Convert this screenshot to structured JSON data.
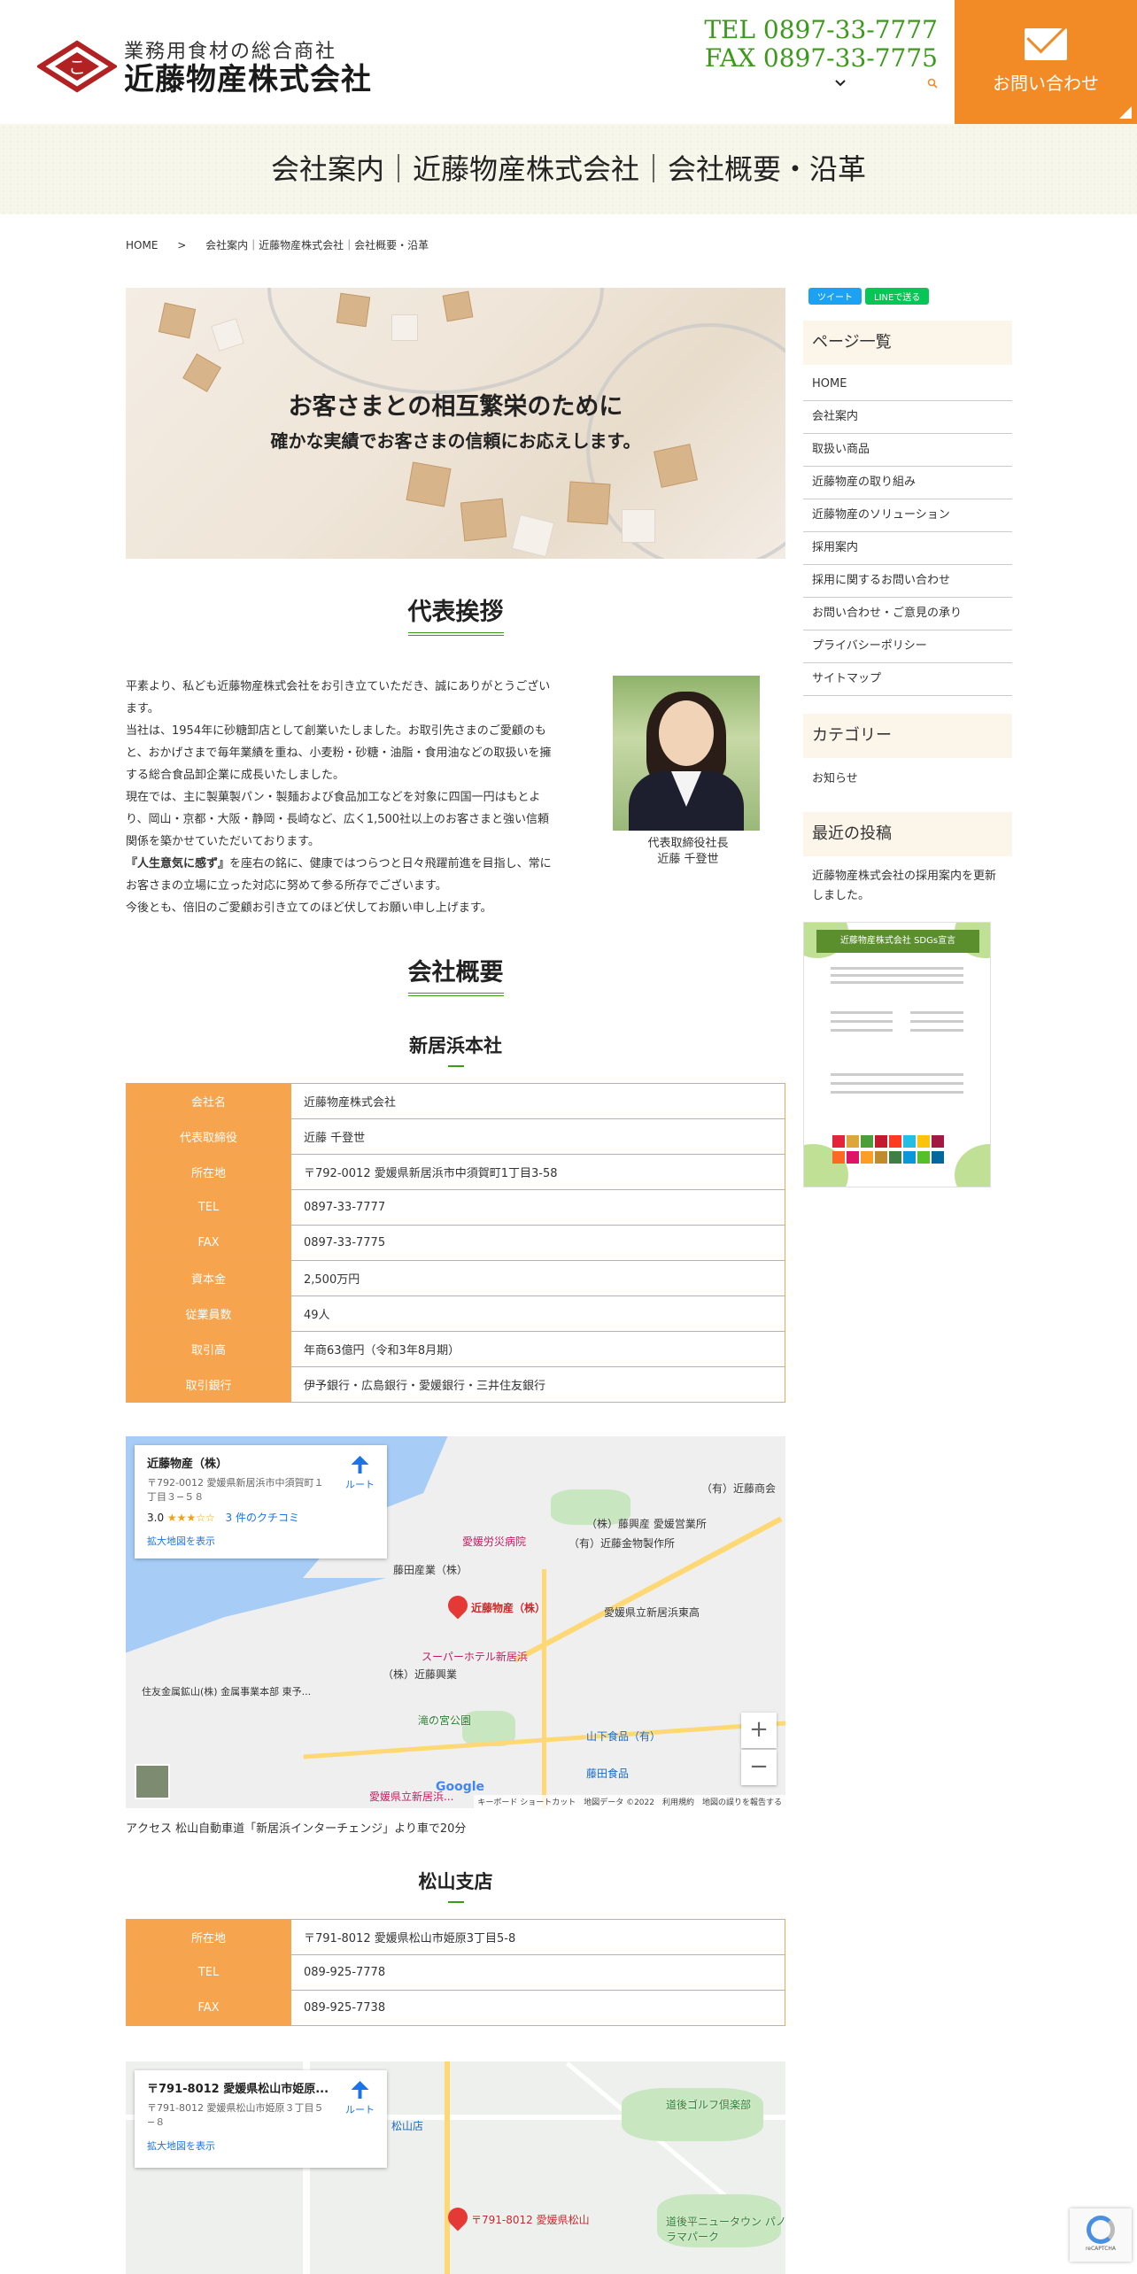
{
  "header": {
    "logo_sub": "業務用食材の総合商社",
    "logo_main": "近藤物産株式会社",
    "tel": "TEL 0897-33-7777",
    "fax": "FAX 0897-33-7775",
    "contact_label": "お問い合わせ"
  },
  "page_title": "会社案内｜近藤物産株式会社｜会社概要・沿革",
  "breadcrumb": {
    "home": "HOME",
    "sep": ">",
    "current": "会社案内｜近藤物産株式会社｜会社概要・沿革"
  },
  "hero": {
    "line1": "お客さまとの相互繁栄のために",
    "line2": "確かな実績でお客さまの信頼にお応えします。"
  },
  "greeting": {
    "title": "代表挨拶",
    "p1": "平素より、私ども近藤物産株式会社をお引き立ていただき、誠にありがとうございます。",
    "p2": "当社は、1954年に砂糖卸店として創業いたしました。お取引先さまのご愛顧のもと、おかげさまで毎年業績を重ね、小麦粉・砂糖・油脂・食用油などの取扱いを擁する総合食品卸企業に成長いたしました。",
    "p3": "現在では、主に製菓製パン・製麺および食品加工などを対象に四国一円はもとより、岡山・京都・大阪・静岡・長崎など、広く1,500社以上のお客さまと強い信頼関係を築かせていただいております。",
    "p4_bold": "『人生意気に感ず』",
    "p4_rest": "を座右の銘に、健康ではつらつと日々飛躍前進を目指し、常にお客さまの立場に立った対応に努めて参る所存でございます。",
    "p5": "今後とも、倍旧のご愛顧お引き立てのほど伏してお願い申し上げます。",
    "caption_role": "代表取締役社長",
    "caption_name": "近藤 千登世"
  },
  "overview": {
    "title": "会社概要",
    "hq_title": "新居浜本社",
    "hq_rows": [
      {
        "k": "会社名",
        "v": "近藤物産株式会社"
      },
      {
        "k": "代表取締役",
        "v": "近藤 千登世"
      },
      {
        "k": "所在地",
        "v": "〒792-0012 愛媛県新居浜市中須賀町1丁目3-58"
      },
      {
        "k": "TEL",
        "v": "0897-33-7777"
      },
      {
        "k": "FAX",
        "v": "0897-33-7775"
      },
      {
        "k": "資本金",
        "v": "2,500万円"
      },
      {
        "k": "従業員数",
        "v": "49人"
      },
      {
        "k": "取引高",
        "v": "年商63億円（令和3年8月期）"
      },
      {
        "k": "取引銀行",
        "v": "伊予銀行・広島銀行・愛媛銀行・三井住友銀行"
      }
    ],
    "access": "アクセス 松山自動車道「新居浜インターチェンジ」より車で20分",
    "branch_title": "松山支店",
    "branch_rows": [
      {
        "k": "所在地",
        "v": "〒791-8012 愛媛県松山市姫原3丁目5-8"
      },
      {
        "k": "TEL",
        "v": "089-925-7778"
      },
      {
        "k": "FAX",
        "v": "089-925-7738"
      }
    ]
  },
  "map1": {
    "name": "近藤物産（株）",
    "address": "〒792-0012 愛媛県新居浜市中須賀町１丁目３−５８",
    "rating": "3.0",
    "stars": "★★★☆☆",
    "reviews": "3 件のクチコミ",
    "large_map": "拡大地図を表示",
    "route": "ルート",
    "pin_label": "近藤物産（株）",
    "labels": [
      "（有）近藤商会",
      "（株）藤興産 愛媛営業所",
      "（有）近藤金物製作所",
      "愛媛労災病院",
      "藤田産業（株）",
      "愛媛県立新居浜東高",
      "スーパーホテル新居浜",
      "（株）近藤興業",
      "住友金属鉱山(株) 金属事業本部 東予...",
      "山下食品（有）",
      "藤田食品",
      "滝の宮公園",
      "愛媛県立新居浜..."
    ],
    "footer": "キーボード ショートカット　地図データ ©2022　利用規約　地図の誤りを報告する",
    "google": "Google",
    "zoom_in": "+",
    "zoom_out": "−"
  },
  "map2": {
    "name": "〒791-8012 愛媛県松山市姫原...",
    "address": "〒791-8012 愛媛県松山市姫原３丁目５−８",
    "large_map": "拡大地図を表示",
    "route": "ルート",
    "pin_label": "〒791-8012 愛媛県松山",
    "labels": [
      "道後ゴルフ倶楽部",
      "道後平ニュータウン パノラマパーク",
      "松山店"
    ]
  },
  "sidebar": {
    "tweet": "ツイート",
    "line": "LINEで送る",
    "pages_title": "ページ一覧",
    "pages": [
      "HOME",
      "会社案内",
      "取扱い商品",
      "近藤物産の取り組み",
      "近藤物産のソリューション",
      "採用案内",
      "採用に関するお問い合わせ",
      "お問い合わせ・ご意見の承り",
      "プライバシーポリシー",
      "サイトマップ"
    ],
    "cat_title": "カテゴリー",
    "cat_item": "お知らせ",
    "recent_title": "最近の投稿",
    "recent_item": "近藤物産株式会社の採用案内を更新しました。",
    "sdgs_head": "近藤物産株式会社 SDGs宣言"
  },
  "colors": {
    "accent_orange": "#f28a26",
    "table_key": "#f7a44e",
    "accent_green": "#3a9a1a"
  }
}
